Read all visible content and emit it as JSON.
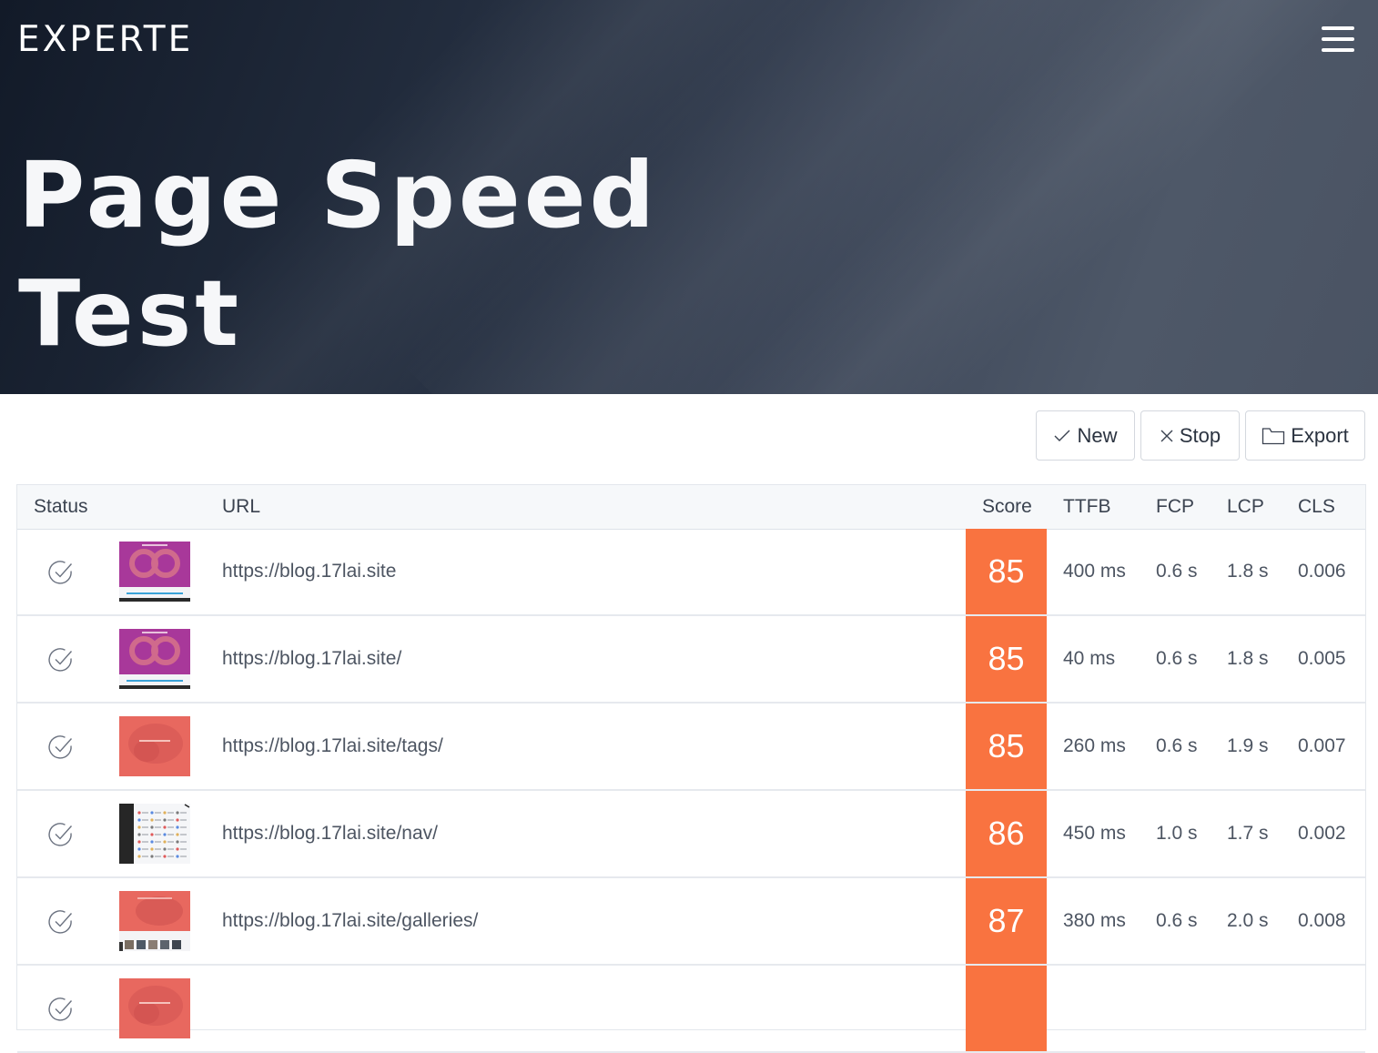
{
  "header": {
    "logo": "EXPERTE",
    "title_line1": "Page Speed",
    "title_line2": "Test"
  },
  "toolbar": {
    "new_label": "New",
    "stop_label": "Stop",
    "export_label": "Export"
  },
  "table": {
    "columns": [
      "Status",
      "URL",
      "Score",
      "TTFB",
      "FCP",
      "LCP",
      "CLS"
    ],
    "rows": [
      {
        "url": "https://blog.17lai.site",
        "score": "85",
        "ttfb": "400 ms",
        "fcp": "0.6 s",
        "lcp": "1.8 s",
        "cls": "0.006",
        "thumb": "purple"
      },
      {
        "url": "https://blog.17lai.site/",
        "score": "85",
        "ttfb": "40 ms",
        "fcp": "0.6 s",
        "lcp": "1.8 s",
        "cls": "0.005",
        "thumb": "purple"
      },
      {
        "url": "https://blog.17lai.site/tags/",
        "score": "85",
        "ttfb": "260 ms",
        "fcp": "0.6 s",
        "lcp": "1.9 s",
        "cls": "0.007",
        "thumb": "red"
      },
      {
        "url": "https://blog.17lai.site/nav/",
        "score": "86",
        "ttfb": "450 ms",
        "fcp": "1.0 s",
        "lcp": "1.7 s",
        "cls": "0.002",
        "thumb": "nav"
      },
      {
        "url": "https://blog.17lai.site/galleries/",
        "score": "87",
        "ttfb": "380 ms",
        "fcp": "0.6 s",
        "lcp": "2.0 s",
        "cls": "0.008",
        "thumb": "gallery"
      },
      {
        "url": "",
        "score": "",
        "ttfb": "",
        "fcp": "",
        "lcp": "",
        "cls": "",
        "thumb": "red"
      }
    ]
  },
  "colors": {
    "score_orange": "#f97340",
    "hero_dark": "#121a28",
    "hero_light": "#4e5868"
  },
  "icons": {
    "menu": "hamburger-menu-icon",
    "new": "checkmark-icon",
    "stop": "x-close-icon",
    "export": "folder-icon",
    "status": "check-circle-icon"
  }
}
